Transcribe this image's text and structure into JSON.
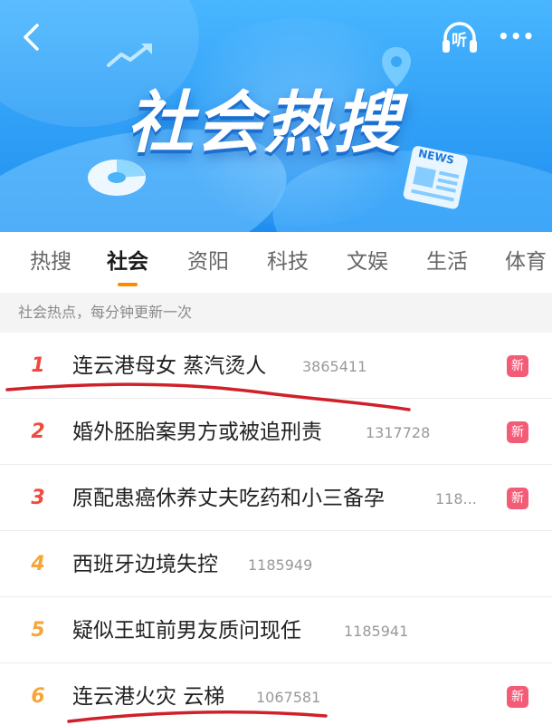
{
  "header": {
    "title": "社会热搜",
    "news_tag": "NEWS",
    "listen_label": "听",
    "more_label": "•••",
    "colors": {
      "banner_top": "#49b6ff",
      "banner_bottom": "#1f8ef0"
    }
  },
  "tabs": [
    {
      "label": "热搜",
      "active": false
    },
    {
      "label": "社会",
      "active": true
    },
    {
      "label": "资阳",
      "active": false
    },
    {
      "label": "科技",
      "active": false
    },
    {
      "label": "文娱",
      "active": false
    },
    {
      "label": "生活",
      "active": false
    },
    {
      "label": "体育",
      "active": false
    }
  ],
  "section_hint": "社会热点，每分钟更新一次",
  "list": [
    {
      "rank": "1",
      "title": "连云港母女 蒸汽烫人",
      "count": "3865411",
      "badge": "新"
    },
    {
      "rank": "2",
      "title": "婚外胚胎案男方或被追刑责",
      "count": "1317728",
      "badge": "新"
    },
    {
      "rank": "3",
      "title": "原配患癌休养丈夫吃药和小三备孕",
      "count": "118...",
      "badge": "新"
    },
    {
      "rank": "4",
      "title": "西班牙边境失控",
      "count": "1185949",
      "badge": ""
    },
    {
      "rank": "5",
      "title": "疑似王虹前男友质问现任",
      "count": "1185941",
      "badge": ""
    },
    {
      "rank": "6",
      "title": "连云港火灾 云梯",
      "count": "1067581",
      "badge": "新"
    }
  ],
  "colors": {
    "accent": "#ff8a00",
    "rank_top": "#f04a3e",
    "rank_other": "#f6a53a",
    "badge_new": "#f35c77",
    "annotation_mark": "#d0202a"
  }
}
